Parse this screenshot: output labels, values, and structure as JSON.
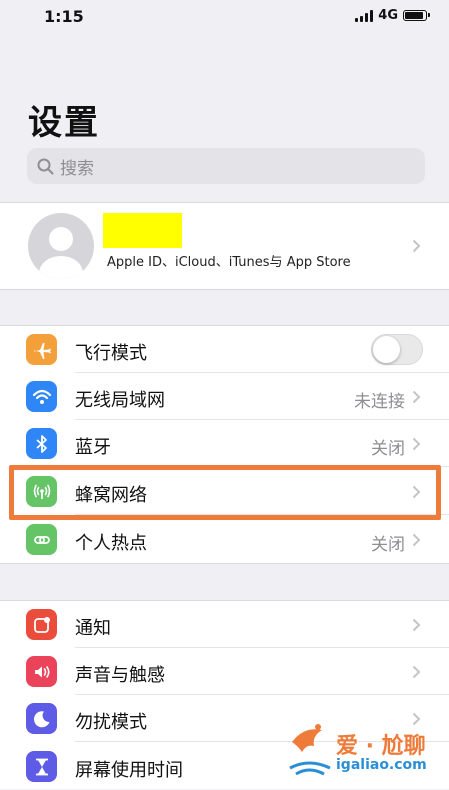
{
  "status_bar": {
    "time": "1:15",
    "network": "4G",
    "battery_level": 0.8
  },
  "header": {
    "title": "设置"
  },
  "search": {
    "placeholder": "搜索"
  },
  "profile": {
    "subtitle": "Apple ID、iCloud、iTunes与 App Store"
  },
  "connectivity": {
    "airplane": {
      "label": "飞行模式",
      "toggle_on": false
    },
    "wifi": {
      "label": "无线局域网",
      "value": "未连接"
    },
    "bluetooth": {
      "label": "蓝牙",
      "value": "关闭"
    },
    "cellular": {
      "label": "蜂窝网络"
    },
    "hotspot": {
      "label": "个人热点",
      "value": "关闭"
    }
  },
  "notifications_group": {
    "notifications": {
      "label": "通知"
    },
    "sounds": {
      "label": "声音与触感"
    },
    "dnd": {
      "label": "勿扰模式"
    },
    "screen_time": {
      "label": "屏幕使用时间"
    }
  },
  "watermark": {
    "main": "爱 · 尬聊",
    "url": "igaliao.com"
  },
  "colors": {
    "airplane": "#f4a03a",
    "wifi": "#2f86f6",
    "bluetooth": "#2f86f6",
    "cellular": "#65c466",
    "hotspot": "#65c466",
    "notifications": "#eb4d3d",
    "sounds": "#eb445a",
    "dnd": "#5e5ce6",
    "screen_time": "#5e5ce6",
    "highlight": "#ef7b3a"
  }
}
